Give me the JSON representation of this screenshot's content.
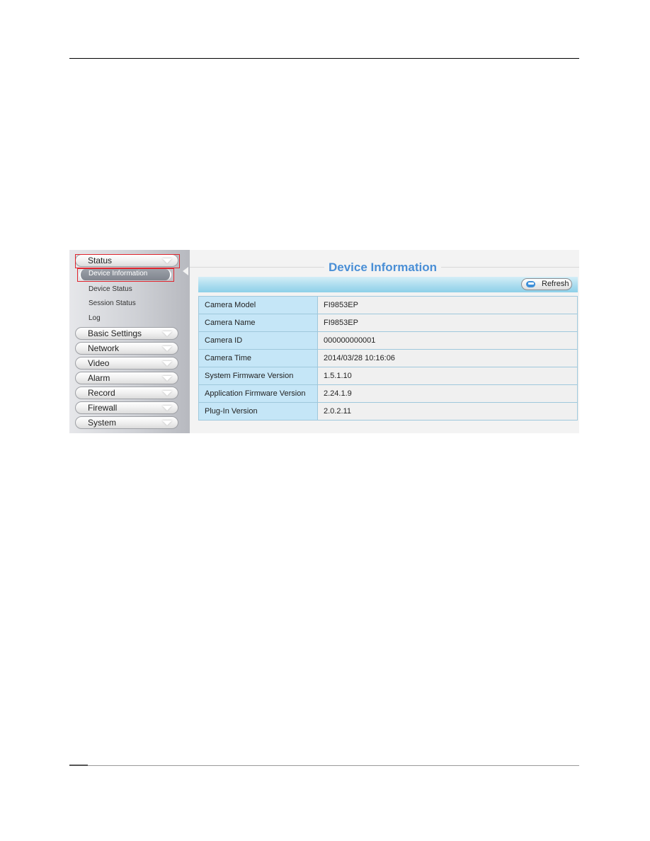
{
  "sidebar": {
    "sections": [
      {
        "label": "Status",
        "expanded": true,
        "highlighted": true
      },
      {
        "label": "Basic Settings"
      },
      {
        "label": "Network"
      },
      {
        "label": "Video"
      },
      {
        "label": "Alarm"
      },
      {
        "label": "Record"
      },
      {
        "label": "Firewall"
      },
      {
        "label": "System"
      }
    ],
    "status_items": [
      {
        "label": "Device Information",
        "active": true,
        "highlighted": true
      },
      {
        "label": "Device Status"
      },
      {
        "label": "Session Status"
      },
      {
        "label": "Log"
      }
    ]
  },
  "main": {
    "title": "Device Information",
    "refresh_label": "Refresh",
    "rows": [
      {
        "key": "Camera Model",
        "value": "FI9853EP"
      },
      {
        "key": "Camera Name",
        "value": "FI9853EP"
      },
      {
        "key": "Camera ID",
        "value": "000000000001"
      },
      {
        "key": "Camera Time",
        "value": "2014/03/28 10:16:06"
      },
      {
        "key": "System Firmware Version",
        "value": "1.5.1.10"
      },
      {
        "key": "Application Firmware Version",
        "value": "2.24.1.9"
      },
      {
        "key": "Plug-In Version",
        "value": "2.0.2.11"
      }
    ]
  },
  "colors": {
    "title": "#4a8fd6",
    "highlight": "#e0252e",
    "key_cell": "#c5e6f7",
    "toolbar": "#a7dbee"
  }
}
